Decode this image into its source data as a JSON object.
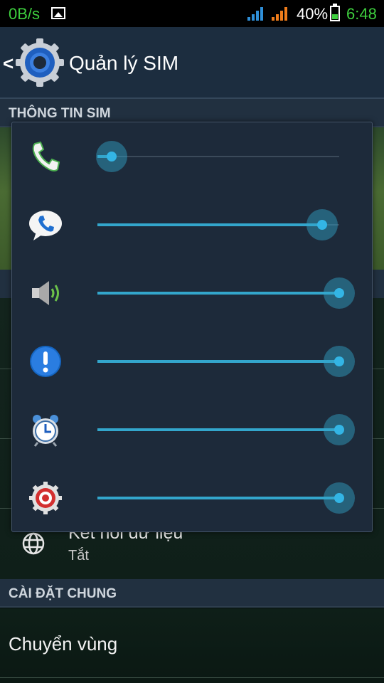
{
  "status_bar": {
    "net_speed": "0B/s",
    "battery_percent": "40%",
    "time": "6:48",
    "icons": [
      "gallery-icon",
      "signal-sim1-icon",
      "signal-sim2-icon",
      "battery-icon"
    ],
    "colors": {
      "green": "#3ecf3e",
      "sim1_signal": "#2f8fd8",
      "sim2_signal": "#f07d1b"
    }
  },
  "action_bar": {
    "title": "Quản lý SIM",
    "icons": [
      "back-icon",
      "settings-logo-icon"
    ]
  },
  "sections": {
    "sim_info_header": "THÔNG TIN SIM",
    "general_header": "CÀI ĐẶT CHUNG"
  },
  "data_connection": {
    "title": "Kết nối dữ liệu",
    "subtitle": "Tắt",
    "icon": "globe-icon"
  },
  "roaming": {
    "title": "Chuyển vùng"
  },
  "volume_dialog": {
    "accent_color": "#33b5e5",
    "sliders": [
      {
        "name": "call",
        "icon": "phone-call-icon",
        "level": 0.06
      },
      {
        "name": "ringtone",
        "icon": "phone-bubble-icon",
        "level": 0.93
      },
      {
        "name": "media",
        "icon": "speaker-icon",
        "level": 1.0
      },
      {
        "name": "notification",
        "icon": "alert-icon",
        "level": 1.0
      },
      {
        "name": "alarm",
        "icon": "alarm-clock-icon",
        "level": 1.0
      },
      {
        "name": "system",
        "icon": "system-gear-icon",
        "level": 1.0
      }
    ]
  }
}
